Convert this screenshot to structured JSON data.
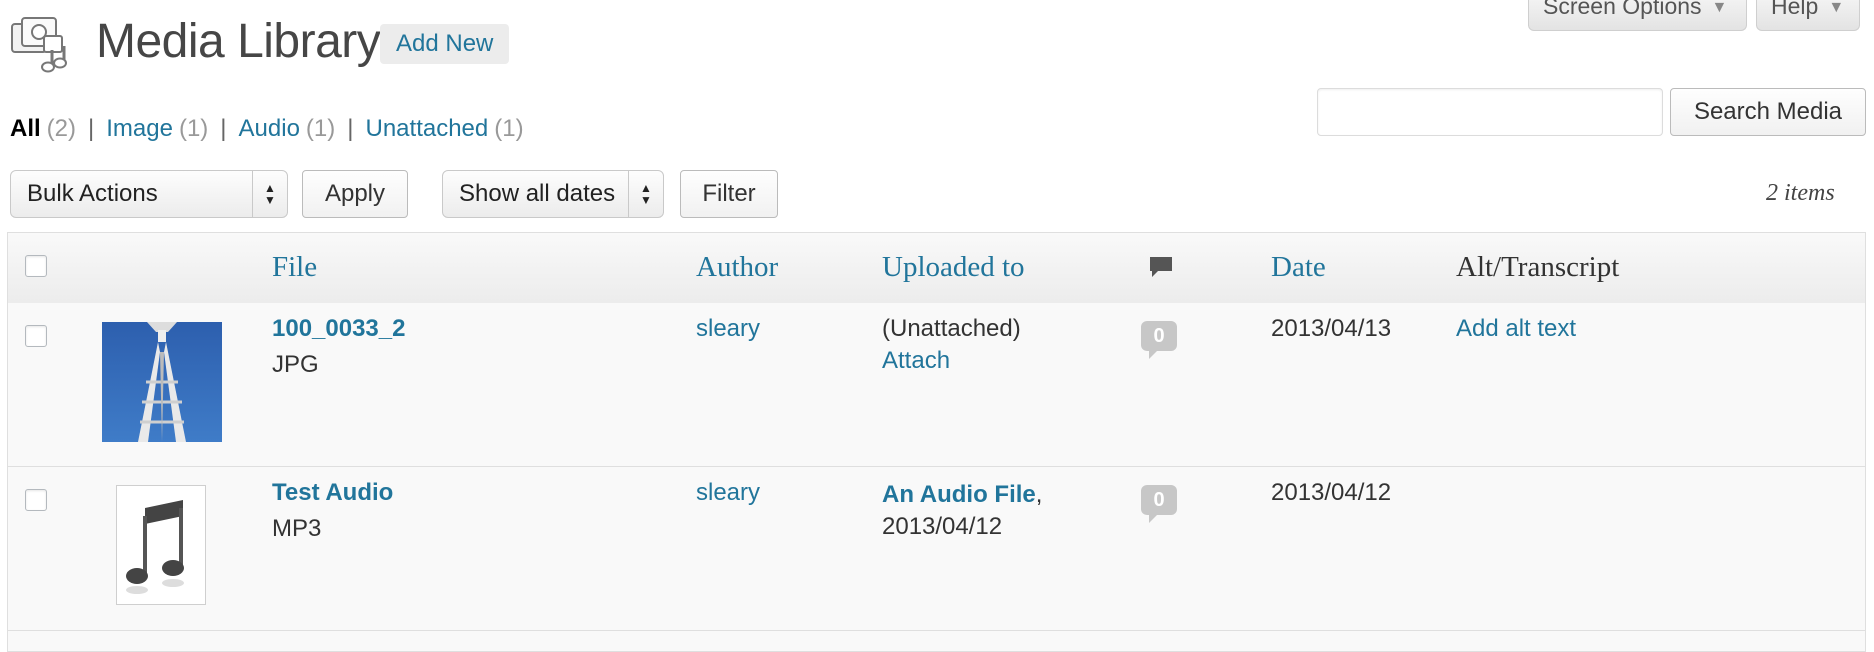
{
  "top_tabs": {
    "screen_options": "Screen Options",
    "help": "Help"
  },
  "header": {
    "title": "Media Library",
    "add_new": "Add New"
  },
  "filters": [
    {
      "label": "All",
      "count": "(2)"
    },
    {
      "label": "Image",
      "count": "(1)"
    },
    {
      "label": "Audio",
      "count": "(1)"
    },
    {
      "label": "Unattached",
      "count": "(1)"
    }
  ],
  "filter_separator": "|",
  "search": {
    "value": "",
    "button": "Search Media"
  },
  "tablenav": {
    "bulk_actions": "Bulk Actions",
    "apply": "Apply",
    "dates": "Show all dates",
    "filter": "Filter",
    "items_count": "2 items"
  },
  "table": {
    "columns": {
      "file": "File",
      "author": "Author",
      "uploaded_to": "Uploaded to",
      "date": "Date",
      "alt": "Alt/Transcript"
    },
    "rows": [
      {
        "title": "100_0033_2",
        "ext": "JPG",
        "author": "sleary",
        "uploaded_to_text": "(Unattached)",
        "uploaded_to_link": "Attach",
        "comments": "0",
        "date": "2013/04/13",
        "alt": "Add alt text"
      },
      {
        "title": "Test Audio",
        "ext": "MP3",
        "author": "sleary",
        "uploaded_to_link": "An Audio File",
        "uploaded_to_date": ", 2013/04/12",
        "comments": "0",
        "date": "2013/04/12",
        "alt": ""
      }
    ]
  },
  "colors": {
    "link": "#21759b",
    "title": "#464646",
    "bubble": "#c7c7c7",
    "header_bg": "#ececec",
    "border": "#dfdfdf"
  },
  "icons": [
    "media-library-icon",
    "comment-icon",
    "image-thumbnail-icon",
    "audio-file-icon"
  ]
}
